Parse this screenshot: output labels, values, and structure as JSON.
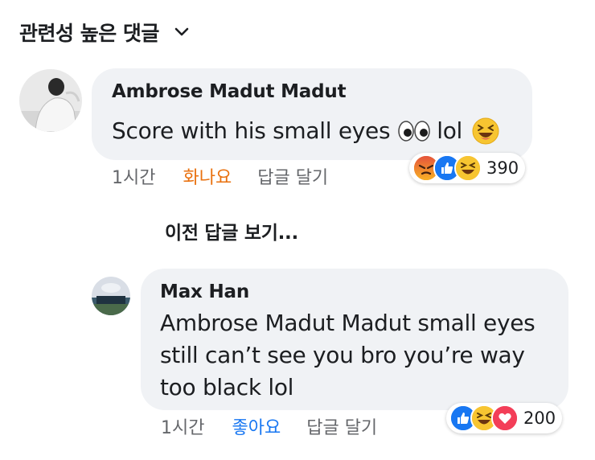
{
  "sort_label": "관련성 높은 댓글",
  "comments": [
    {
      "author": "Ambrose Madut Madut",
      "text": "Score with his small eyes",
      "text_suffix": "lol",
      "inline_emojis": [
        "eyes-emoji",
        "laughing-emoji"
      ],
      "time": "1시간",
      "reaction_action": "화나요",
      "reaction_action_color": "#e9710f",
      "reply_action": "답글 달기",
      "reactions": [
        "angry",
        "like",
        "haha"
      ],
      "reaction_count": "390"
    },
    {
      "author": "Max Han",
      "text": "Ambrose Madut Madut small eyes still can’t see you bro you’re way too black lol",
      "time": "1시간",
      "reaction_action": "좋아요",
      "reaction_action_color": "#1877f2",
      "reply_action": "답글 달기",
      "reactions": [
        "like",
        "haha",
        "love"
      ],
      "reaction_count": "200"
    }
  ],
  "view_previous": "이전 답글 보기...",
  "colors": {
    "bubble": "#f0f2f5",
    "meta": "#65676b",
    "like": "#1877f2",
    "love": "#f33e58",
    "haha": "#f7b125",
    "angry": "#e9710f"
  }
}
